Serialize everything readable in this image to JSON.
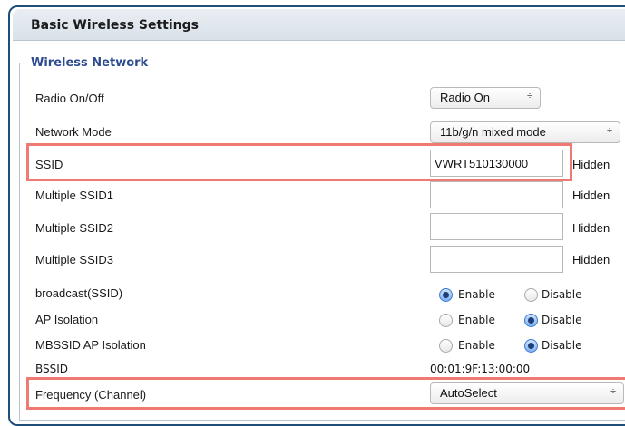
{
  "panel": {
    "title": "Basic Wireless Settings"
  },
  "wireless_network": {
    "legend": "Wireless Network",
    "radio_onoff": {
      "label": "Radio On/Off",
      "value": "Radio On"
    },
    "network_mode": {
      "label": "Network Mode",
      "value": "11b/g/n mixed mode"
    },
    "ssid": {
      "label": "SSID",
      "value": "VWRT510130000",
      "hidden_label": "Hidden"
    },
    "multiple_ssid1": {
      "label": "Multiple SSID1",
      "value": "",
      "hidden_label": "Hidden"
    },
    "multiple_ssid2": {
      "label": "Multiple SSID2",
      "value": "",
      "hidden_label": "Hidden"
    },
    "multiple_ssid3": {
      "label": "Multiple SSID3",
      "value": "",
      "hidden_label": "Hidden"
    },
    "broadcast_ssid": {
      "label": "broadcast(SSID)",
      "enable": "Enable",
      "disable": "Disable",
      "selected": "Enable"
    },
    "ap_isolation": {
      "label": "AP Isolation",
      "enable": "Enable",
      "disable": "Disable",
      "selected": "Disable"
    },
    "mbssid_ap_isolation": {
      "label": "MBSSID AP Isolation",
      "enable": "Enable",
      "disable": "Disable",
      "selected": "Disable"
    },
    "bssid": {
      "label": "BSSID",
      "value": "00:01:9F:13:00:00"
    },
    "frequency": {
      "label": "Frequency (Channel)",
      "value": "AutoSelect"
    }
  },
  "icons": {
    "select_arrow": "updown-arrows-icon"
  },
  "colors": {
    "highlight": "#ef7a73",
    "legend": "#2d4b8f",
    "frame": "#1f4e79"
  }
}
